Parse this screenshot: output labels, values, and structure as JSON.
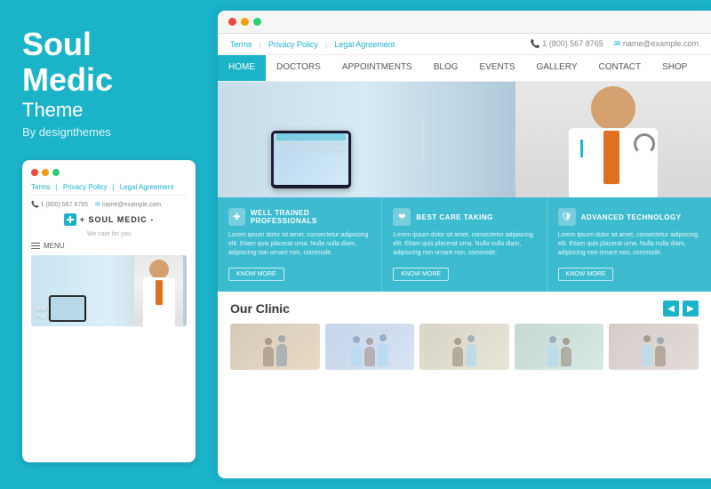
{
  "brand": {
    "title": "Soul",
    "title2": "Medic",
    "subtitle": "Theme",
    "by": "By designthemes"
  },
  "browser": {
    "dots": [
      "red",
      "yellow",
      "green"
    ]
  },
  "topbar": {
    "links": [
      "Terms",
      "Privacy Policy",
      "Legal Agreement"
    ],
    "phone": "1 (800) 567 8765",
    "email": "name@example.com"
  },
  "nav": {
    "items": [
      "HOME",
      "DOCTORS",
      "APPOINTMENTS",
      "BLOG",
      "EVENTS",
      "GALLERY",
      "CONTACT",
      "SHOP"
    ],
    "active": "HOME"
  },
  "hero": {
    "tagline": "We Care for You"
  },
  "features": [
    {
      "icon": "✚",
      "title": "WELL TRAINED PROFESSIONALS",
      "body": "Lorem ipsum dolor sit amet, consectetur adipiscing elit. Etiam quis placerat urna. Nulla nulla diam, adipiscing non ornare non, commode.",
      "btn": "KNOW MORE"
    },
    {
      "icon": "❤",
      "title": "BEST CARE TAKING",
      "body": "Lorem ipsum dolor sit amet, consectetur adipiscing elit. Etiam quis placerat urna. Nulla nulla diam, adipiscing non ornare non, commode.",
      "btn": "KNOW MORE"
    },
    {
      "icon": "🛡",
      "title": "ADVANCED TECHNOLOGY",
      "body": "Lorem ipsum dolor sit amet, consectetur adipiscing elit. Etiam quis placerat urna. Nulla nulla diam, adipiscing non ornare non, commode.",
      "btn": "KNOW MORE"
    }
  ],
  "clinic": {
    "title": "Our Clinic",
    "prev_label": "◀",
    "next_label": "▶",
    "images": [
      1,
      2,
      3,
      4,
      5
    ]
  },
  "mobile_preview": {
    "brand": "SOUL MEDIC",
    "tagline": "We care for you",
    "menu": "MENU",
    "nav_links": [
      "Terms",
      "Privacy Policy",
      "Legal Agreement"
    ],
    "phone": "1 (800) 567 8765",
    "email": "name@example.com"
  }
}
